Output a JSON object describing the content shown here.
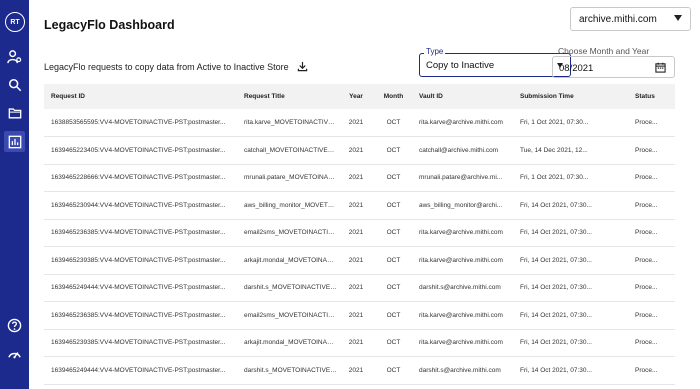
{
  "sidebar": {
    "avatar_initials": "RT",
    "items": [
      {
        "icon": "user-settings-icon"
      },
      {
        "icon": "search-icon"
      },
      {
        "icon": "folder-icon"
      },
      {
        "icon": "dashboard-chart-icon",
        "active": true
      }
    ],
    "bottom_items": [
      {
        "icon": "help-icon"
      },
      {
        "icon": "gauge-icon"
      }
    ],
    "color": "#1b2a8c"
  },
  "header": {
    "title": "LegacyFlo Dashboard",
    "account": "archive.mithi.com"
  },
  "toolbar": {
    "subtitle": "LegacyFlo requests to copy data from Active to Inactive Store",
    "type_label": "Type",
    "type_value": "Copy to Inactive",
    "date_label": "Choose Month and Year",
    "date_value": "08/2021"
  },
  "table": {
    "columns": [
      "Request ID",
      "Request Title",
      "Year",
      "Month",
      "Vault ID",
      "Submission Time",
      "Status"
    ],
    "rows": [
      [
        "1638853565595:VV4-MOVETOINACTIVE-PST:postmaster...",
        "rita.karve_MOVETOINACTIVE_PST_OCT_2021",
        "2021",
        "OCT",
        "rita.karve@archive.mithi.com",
        "Fri, 1 Oct 2021, 07:30...",
        "Proce..."
      ],
      [
        "1639465223405:VV4-MOVETOINACTIVE-PST:postmaster...",
        "catchall_MOVETOINACTIVE_PST_OCT_2021",
        "2021",
        "OCT",
        "catchall@archive.mithi.com",
        "Tue, 14 Dec 2021, 12...",
        "Proce..."
      ],
      [
        "1639465228666:VV4-MOVETOINACTIVE-PST:postmaster...",
        "mrunali.patare_MOVETOINACTIVE_PST_OC...",
        "2021",
        "OCT",
        "mrunali.patare@archive.mi...",
        "Fri, 1 Oct 2021, 07:30...",
        "Proce..."
      ],
      [
        "1639465230944:VV4-MOVETOINACTIVE-PST:postmaster...",
        "aws_billing_monitor_MOVETOINACTIVE_PS...",
        "2021",
        "OCT",
        "aws_billing_monitor@archi...",
        "Fri, 14 Oct 2021, 07:30...",
        "Proce..."
      ],
      [
        "1639465236385:VV4-MOVETOINACTIVE-PST:postmaster...",
        "email2sms_MOVETOINACTIVE_PST_OCT_2...",
        "2021",
        "OCT",
        "rita.karve@archive.mithi.com",
        "Fri, 14 Oct 2021, 07:30...",
        "Proce..."
      ],
      [
        "1639465239385:VV4-MOVETOINACTIVE-PST:postmaster...",
        "arkajit.mondal_MOVETOINACTIVE_PST_OC...",
        "2021",
        "OCT",
        "rita.karve@archive.mithi.com",
        "Fri, 14 Oct 2021, 07:30...",
        "Proce..."
      ],
      [
        "1639465249444:VV4-MOVETOINACTIVE-PST:postmaster...",
        "darshit.s_MOVETOINACTIVE_PST_OCT_2021",
        "2021",
        "OCT",
        "darshit.s@archive.mithi.com",
        "Fri, 14 Oct 2021, 07:30...",
        "Proce..."
      ],
      [
        "1639465236385:VV4-MOVETOINACTIVE-PST:postmaster...",
        "email2sms_MOVETOINACTIVE_PST_OCT_2...",
        "2021",
        "OCT",
        "rita.karve@archive.mithi.com",
        "Fri, 14 Oct 2021, 07:30...",
        "Proce..."
      ],
      [
        "1639465239385:VV4-MOVETOINACTIVE-PST:postmaster...",
        "arkajit.mondal_MOVETOINACTIVE_PST_OC...",
        "2021",
        "OCT",
        "rita.karve@archive.mithi.com",
        "Fri, 14 Oct 2021, 07:30...",
        "Proce..."
      ],
      [
        "1639465249444:VV4-MOVETOINACTIVE-PST:postmaster...",
        "darshit.s_MOVETOINACTIVE_PST_OCT_2021",
        "2021",
        "OCT",
        "darshit.s@archive.mithi.com",
        "Fri, 14 Oct 2021, 07:30...",
        "Proce..."
      ]
    ]
  }
}
